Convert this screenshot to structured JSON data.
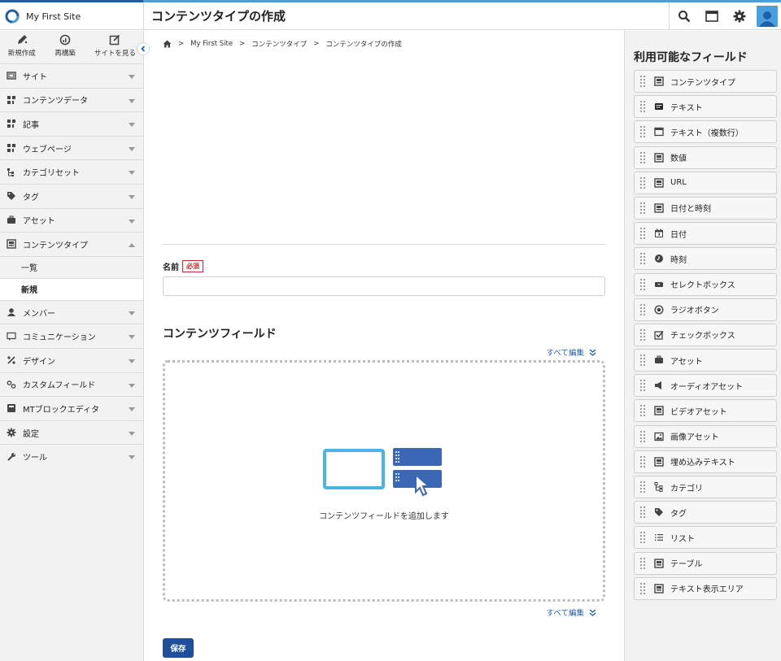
{
  "header": {
    "site_name": "My First Site",
    "page_title": "コンテンツタイプの作成",
    "icons": [
      "search-icon",
      "window-icon",
      "gear-icon",
      "user-avatar-icon"
    ]
  },
  "quick_actions": [
    {
      "label": "新規作成",
      "icon": "pen-icon"
    },
    {
      "label": "再構築",
      "icon": "rebuild-icon"
    },
    {
      "label": "サイトを見る",
      "icon": "external-edit-icon"
    }
  ],
  "sidebar": {
    "items": [
      {
        "label": "サイト",
        "icon": "site-icon"
      },
      {
        "label": "コンテンツデータ",
        "icon": "content-data-icon"
      },
      {
        "label": "記事",
        "icon": "entry-icon"
      },
      {
        "label": "ウェブページ",
        "icon": "page-icon"
      },
      {
        "label": "カテゴリセット",
        "icon": "category-set-icon"
      },
      {
        "label": "タグ",
        "icon": "tag-icon"
      },
      {
        "label": "アセット",
        "icon": "asset-icon"
      },
      {
        "label": "コンテンツタイプ",
        "icon": "content-type-icon"
      }
    ],
    "sub_items": [
      {
        "label": "一覧"
      },
      {
        "label": "新規"
      }
    ],
    "items_after": [
      {
        "label": "メンバー",
        "icon": "member-icon"
      },
      {
        "label": "コミュニケーション",
        "icon": "comment-icon"
      },
      {
        "label": "デザイン",
        "icon": "design-icon"
      },
      {
        "label": "カスタムフィールド",
        "icon": "custom-field-icon"
      },
      {
        "label": "MTブロックエディタ",
        "icon": "block-editor-icon"
      },
      {
        "label": "設定",
        "icon": "settings-icon"
      },
      {
        "label": "ツール",
        "icon": "tool-icon"
      }
    ]
  },
  "breadcrumb": [
    "My First Site",
    "コンテンツタイプ",
    "コンテンツタイプの作成"
  ],
  "form": {
    "name_label": "名前",
    "required_badge": "必須",
    "name_value": "",
    "content_fields_title": "コンテンツフィールド",
    "edit_all": "すべて編集",
    "dropzone_text": "コンテンツフィールドを追加します",
    "save_label": "保存"
  },
  "right_panel": {
    "title": "利用可能なフィールド",
    "fields": [
      {
        "label": "コンテンツタイプ",
        "icon": "content-type-icon"
      },
      {
        "label": "テキスト",
        "icon": "text-icon"
      },
      {
        "label": "テキスト（複数行）",
        "icon": "multiline-text-icon"
      },
      {
        "label": "数値",
        "icon": "number-icon"
      },
      {
        "label": "URL",
        "icon": "url-icon"
      },
      {
        "label": "日付と時刻",
        "icon": "datetime-icon"
      },
      {
        "label": "日付",
        "icon": "calendar-icon"
      },
      {
        "label": "時刻",
        "icon": "clock-icon"
      },
      {
        "label": "セレクトボックス",
        "icon": "select-box-icon"
      },
      {
        "label": "ラジオボタン",
        "icon": "radio-icon"
      },
      {
        "label": "チェックボックス",
        "icon": "checkbox-icon"
      },
      {
        "label": "アセット",
        "icon": "asset-icon"
      },
      {
        "label": "オーディオアセット",
        "icon": "audio-icon"
      },
      {
        "label": "ビデオアセット",
        "icon": "video-icon"
      },
      {
        "label": "画像アセット",
        "icon": "image-icon"
      },
      {
        "label": "埋め込みテキスト",
        "icon": "embed-text-icon"
      },
      {
        "label": "カテゴリ",
        "icon": "category-icon"
      },
      {
        "label": "タグ",
        "icon": "tag-icon"
      },
      {
        "label": "リスト",
        "icon": "list-icon"
      },
      {
        "label": "テーブル",
        "icon": "table-icon"
      },
      {
        "label": "テキスト表示エリア",
        "icon": "text-display-icon"
      }
    ]
  }
}
